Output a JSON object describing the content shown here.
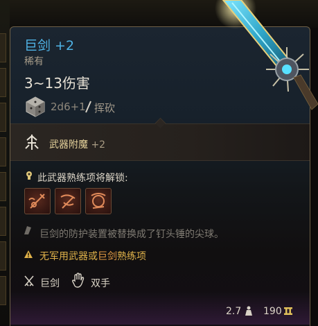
{
  "item": {
    "name": "巨剑 +2",
    "rarity": "稀有",
    "damage": "3~13伤害",
    "dice": "2d6+1",
    "damage_type": "挥砍",
    "icon": "greatsword-art"
  },
  "enchantment": {
    "label": "武器附魔",
    "bonus": "+2",
    "icon": "weapon-enchant-icon"
  },
  "proficiency": {
    "unlock_label": "此武器熟练项将解锁:",
    "actions": [
      {
        "icon": "action-skill-1-icon"
      },
      {
        "icon": "action-skill-2-icon"
      },
      {
        "icon": "action-skill-3-icon"
      }
    ]
  },
  "description": "巨剑的防护装置被替换成了钉头锤的尖球。",
  "warning": {
    "prefix": "无军用武器或",
    "highlight": "巨剑",
    "suffix": "熟练项"
  },
  "tags": [
    {
      "label": "巨剑",
      "icon": "crossed-swords-icon"
    },
    {
      "label": "双手",
      "icon": "hand-icon"
    }
  ],
  "footer": {
    "weight": "2.7",
    "price": "190"
  },
  "colors": {
    "title": "#4fb3e6",
    "warning": "#e0b24a",
    "enchant": "#e6d39c",
    "border": "#6e6047"
  }
}
